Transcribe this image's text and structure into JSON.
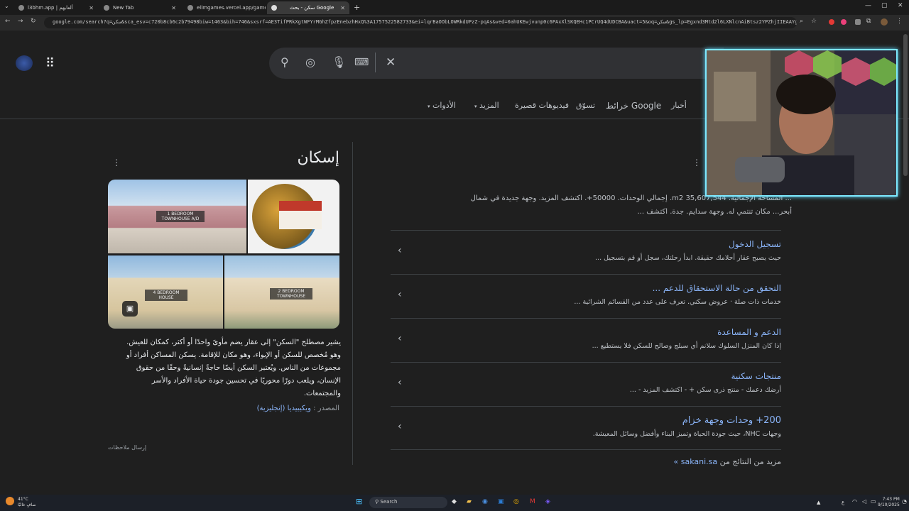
{
  "browser": {
    "tabs": [
      {
        "label": "l3bhm.app | ألعابهم"
      },
      {
        "label": "New Tab"
      },
      {
        "label": "ellmgames.vercel.app/game..."
      },
      {
        "label": "سكن - بحث Google"
      }
    ],
    "url": "google.com/search?q=سكن&sca_esv=c720b8cb6c2b79498biw=1463&bih=746&sxsrf=AE3TifPRkXgtWFYrMGhZfpzEnebzhHxQ%3A1757522582733&ei=lqrBaOObLOWRkdUPzZ-pqAs&ved=0ahUKEwjvunp0c6PAxXlSKQEHc1PCrUQ4dUDCBA&uact=5&oq=سكن&gs_lp=Egxnd3Mtd2l6LXNlcnAiBtsz2YPZhjIIEAAYgAQYsQMyBRAAGIAEMgU..."
  },
  "nav": {
    "tools": "الأدوات",
    "more": "المزيد",
    "shorts": "فيديوهات قصيرة",
    "shopping": "تسوّق",
    "maps": "خرائط Google",
    "news": "أخبار"
  },
  "knowledge_panel": {
    "title": "إسكان",
    "image_labels": [
      "1 BEDROOM TOWNHOUSE A/D",
      "4 BEDROOM HOUSE",
      "2 BEDROOM TOWNHOUSE"
    ],
    "description": "يشير مصطلح \"السكن\" إلى عقار يضم مأوىً واحدًا أو أكثر، كمكان للعيش. وهو مُخصص للسكن أو الإيواء، وهو مكان للإقامة. يسكن المساكن أفراد أو مجموعات من الناس. ويُعتبر السكن أيضًا حاجةً إنسانيةً وحقًا من حقوق الإنسان، ويلعب دورًا محوريًا في تحسين جودة حياة الأفراد والأسر والمجتمعات.",
    "source_label": "المصدر :",
    "source_link": "ويكيبيديا (إنجليزية)",
    "feedback": "إرسال ملاحظات"
  },
  "results": {
    "snippet_line1": "... المساحة الإجمالية. 35,607,544 m2. إجمالي الوحدات. 50000+. اكتشف المزيد. وجهة جديدة في شمال",
    "snippet_line2": "أبحر... مكان تنتمي له. وجهة سدايم. جدة. اكتشف ...",
    "sitelinks": [
      {
        "title": "تسجيل الدخول",
        "desc": "حيث يصبح عقار أحلامك حقيقة. ابدأ رحلتك، سجل أو قم بتسجيل ..."
      },
      {
        "title": "التحقق من حالة الاستحقاق للدعم ...",
        "desc": "خدمات ذات صلة · عروض سكني. تعرف على عدد من القسائم الشرائية ..."
      },
      {
        "title": "الدعم و المساعدة",
        "desc": "إذا كان المنزل السلوك سلانم أي سبلج وصالح للسكن فلا يستطيع ..."
      },
      {
        "title": "منتجات سكنية",
        "desc": "أرضك دعمك - منتج ذرى سكن + - اكتشف المزيد - ..."
      },
      {
        "title": "200+ وحدات وجهة خزام",
        "desc": "وجهات NHC، حيث جودة الحياة وتميز البناء وأفضل وسائل المعيشة."
      }
    ],
    "more_prefix": "مزيد من النتائج من",
    "more_link": "sakani.sa »"
  },
  "taskbar": {
    "weather_temp": "41°C",
    "weather_desc": "صافٍ غالبًا",
    "search_label": "Search",
    "time": "7:43 PM",
    "date": "9/10/2025"
  }
}
